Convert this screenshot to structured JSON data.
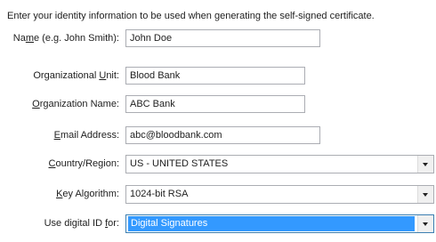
{
  "intro_text": "Enter your identity information to be used when generating the self-signed certificate.",
  "fields": {
    "name": {
      "label_pre": "Na",
      "label_key": "m",
      "label_post": "e (e.g. John Smith):",
      "value": "John Doe"
    },
    "org_unit": {
      "label_pre": "Organizational ",
      "label_key": "U",
      "label_post": "nit:",
      "value": "Blood Bank"
    },
    "org_name": {
      "label_pre": "",
      "label_key": "O",
      "label_post": "rganization Name:",
      "value": "ABC Bank"
    },
    "email": {
      "label_pre": "",
      "label_key": "E",
      "label_post": "mail Address:",
      "value": "abc@bloodbank.com"
    },
    "country": {
      "label_pre": "",
      "label_key": "C",
      "label_post": "ountry/Region:",
      "value": "US - UNITED STATES"
    },
    "key_algorithm": {
      "label_pre": "",
      "label_key": "K",
      "label_post": "ey Algorithm:",
      "value": "1024-bit RSA"
    },
    "use_for": {
      "label_pre": "Use digital ID ",
      "label_key": "f",
      "label_post": "or:",
      "value": "Digital Signatures"
    }
  },
  "colors": {
    "selection": "#3399ff",
    "border": "#abadb3"
  },
  "icons": {
    "dropdown": "chevron-down-icon"
  }
}
